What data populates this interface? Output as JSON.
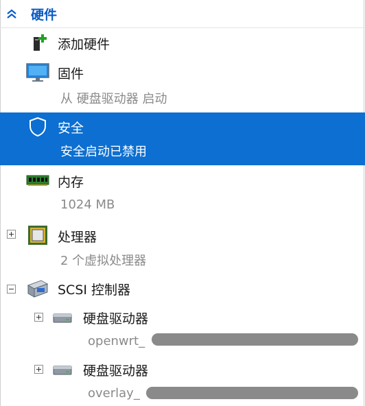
{
  "section": {
    "title": "硬件"
  },
  "items": [
    {
      "label": "添加硬件"
    },
    {
      "label": "固件",
      "sub": "从 硬盘驱动器 启动"
    },
    {
      "label": "安全",
      "sub": "安全启动已禁用"
    },
    {
      "label": "内存",
      "sub": "1024 MB"
    },
    {
      "label": "处理器",
      "sub": "2 个虚拟处理器"
    },
    {
      "label": "SCSI 控制器"
    }
  ],
  "drives": [
    {
      "label": "硬盘驱动器",
      "sub": "openwrt_"
    },
    {
      "label": "硬盘驱动器",
      "sub": "overlay_"
    }
  ],
  "colors": {
    "selection": "#0c6fd1",
    "header_text": "#0a5bc4",
    "secondary_text": "#8a8a8a"
  }
}
